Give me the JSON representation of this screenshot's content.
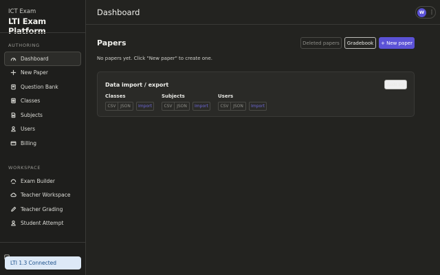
{
  "brand": {
    "subtitle": "ICT Exam",
    "title": "LTI Exam Platform"
  },
  "sidebar": {
    "authoring_label": "AUTHORING",
    "authoring_items": [
      {
        "label": "Dashboard",
        "icon": "dashboard-icon",
        "active": true
      },
      {
        "label": "New Paper",
        "icon": "plus-icon",
        "active": false
      },
      {
        "label": "Question Bank",
        "icon": "book-icon",
        "active": false
      },
      {
        "label": "Classes",
        "icon": "list-icon",
        "active": false
      },
      {
        "label": "Subjects",
        "icon": "document-icon",
        "active": false
      },
      {
        "label": "Users",
        "icon": "user-icon",
        "active": false
      },
      {
        "label": "Billing",
        "icon": "card-icon",
        "active": false
      }
    ],
    "workspace_label": "WORKSPACE",
    "workspace_items": [
      {
        "label": "Exam Builder",
        "icon": "sparkle-icon"
      },
      {
        "label": "Teacher Workspace",
        "icon": "cloud-icon"
      },
      {
        "label": "Teacher Grading",
        "icon": "pencil-icon"
      },
      {
        "label": "Student Attempt",
        "icon": "user-icon"
      }
    ],
    "status_badge": "LTI 1.3 Connected"
  },
  "header": {
    "title": "Dashboard",
    "avatar_initial": "W",
    "menu_glyph": "⋮"
  },
  "main": {
    "section_title": "Papers",
    "buttons": {
      "deleted": "Deleted papers",
      "gradebook": "Gradebook",
      "new_paper": "+ New paper"
    },
    "empty_message": "No papers yet. Click \"New paper\" to create one."
  },
  "data_card": {
    "title": "Data import / export",
    "audit_label": "Audit log",
    "groups": [
      {
        "label": "Classes",
        "csv": "CSV",
        "json": "JSON",
        "import": "Import"
      },
      {
        "label": "Subjects",
        "csv": "CSV",
        "json": "JSON",
        "import": "Import"
      },
      {
        "label": "Users",
        "csv": "CSV",
        "json": "JSON",
        "import": "Import"
      }
    ]
  },
  "colors": {
    "accent": "#5b52d6",
    "badge_bg": "#dde9f7",
    "badge_text": "#1a4f8a",
    "background": "#232320"
  }
}
